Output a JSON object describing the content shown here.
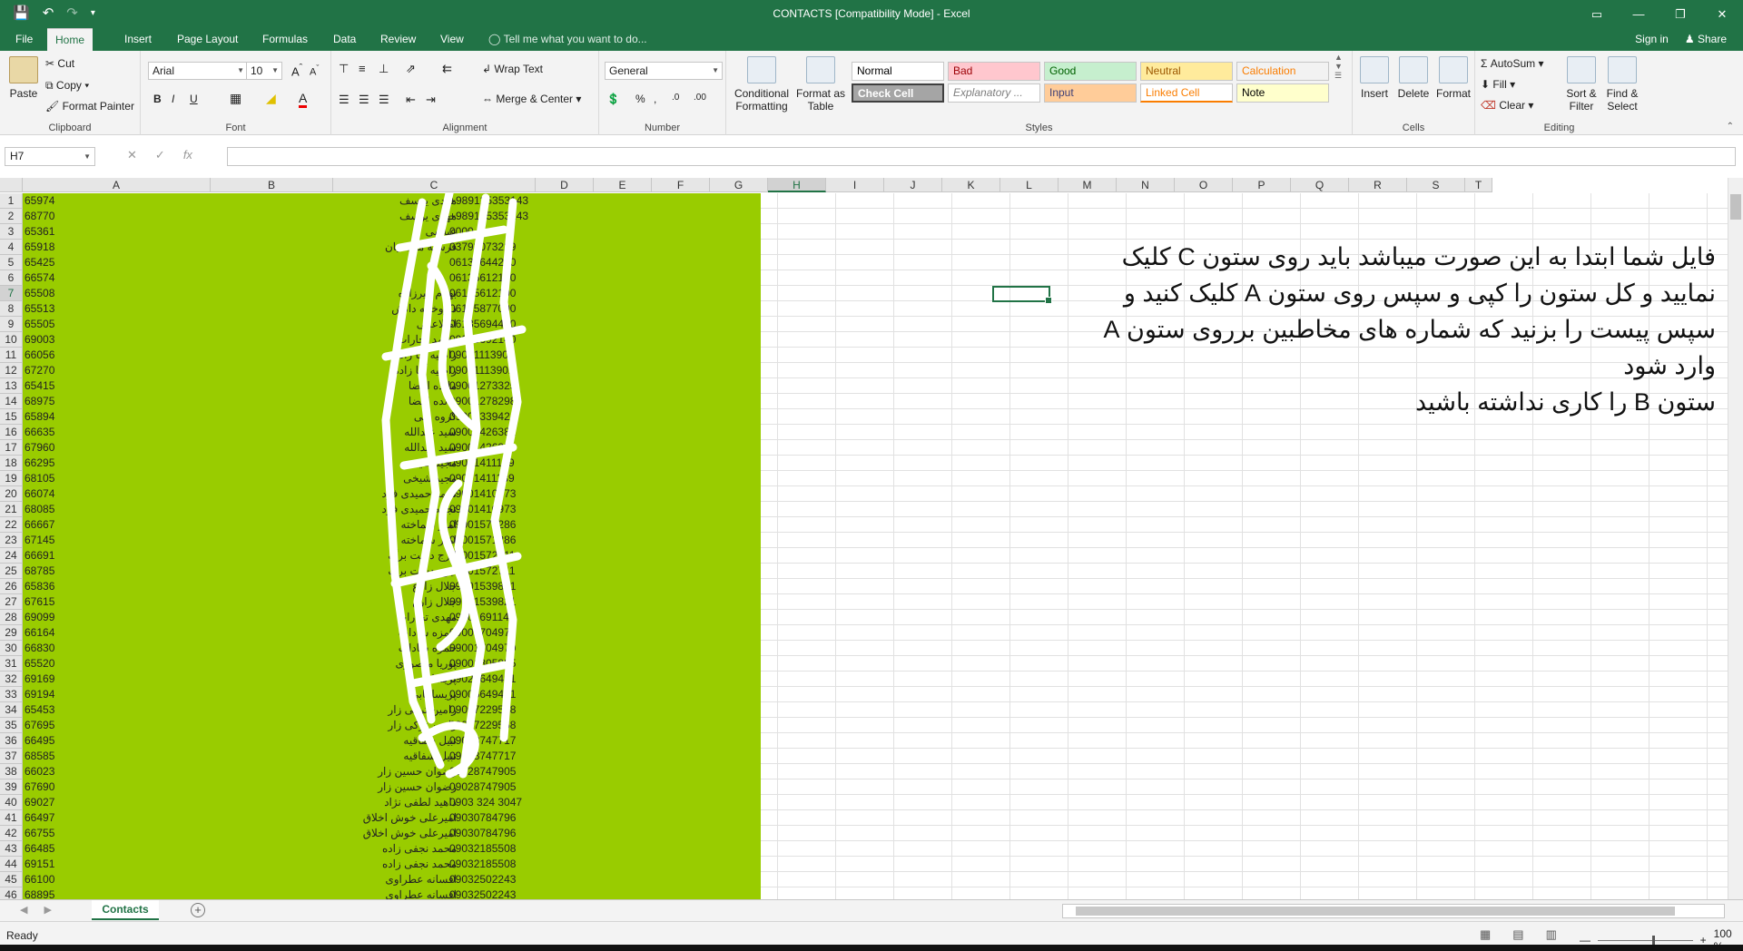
{
  "app": {
    "title": "CONTACTS  [Compatibility Mode] - Excel"
  },
  "tabs": [
    "File",
    "Home",
    "Insert",
    "Page Layout",
    "Formulas",
    "Data",
    "Review",
    "View"
  ],
  "tell_me": "Tell me what you want to do...",
  "account": {
    "signin": "Sign in",
    "share": "Share"
  },
  "ribbon": {
    "clipboard": {
      "label": "Clipboard",
      "paste": "Paste",
      "cut": "Cut",
      "copy": "Copy",
      "format_painter": "Format Painter"
    },
    "font": {
      "label": "Font",
      "name": "Arial",
      "size": "10"
    },
    "alignment": {
      "label": "Alignment",
      "wrap": "Wrap Text",
      "merge": "Merge & Center"
    },
    "number": {
      "label": "Number",
      "format": "General"
    },
    "styles": {
      "label": "Styles",
      "conditional": "Conditional Formatting",
      "format_table": "Format as Table",
      "cells": [
        {
          "name": "Normal",
          "bg": "#ffffff",
          "fg": "#000000"
        },
        {
          "name": "Bad",
          "bg": "#ffc7ce",
          "fg": "#9c0006"
        },
        {
          "name": "Good",
          "bg": "#c6efce",
          "fg": "#006100"
        },
        {
          "name": "Neutral",
          "bg": "#ffeb9c",
          "fg": "#9c5700"
        },
        {
          "name": "Calculation",
          "bg": "#f2f2f2",
          "fg": "#fa7d00"
        },
        {
          "name": "Check Cell",
          "bg": "#a5a5a5",
          "fg": "#ffffff"
        },
        {
          "name": "Explanatory ...",
          "bg": "#ffffff",
          "fg": "#7f7f7f"
        },
        {
          "name": "Input",
          "bg": "#ffcc99",
          "fg": "#3f3f76"
        },
        {
          "name": "Linked Cell",
          "bg": "#ffffff",
          "fg": "#fa7d00"
        },
        {
          "name": "Note",
          "bg": "#ffffcc",
          "fg": "#000000"
        }
      ]
    },
    "cells": {
      "label": "Cells",
      "insert": "Insert",
      "delete": "Delete",
      "format": "Format"
    },
    "editing": {
      "label": "Editing",
      "autosum": "AutoSum",
      "fill": "Fill",
      "clear": "Clear",
      "sort": "Sort & Filter",
      "find": "Find & Select"
    }
  },
  "formula": {
    "namebox": "H7",
    "value": ""
  },
  "columns": [
    "A",
    "B",
    "C",
    "D",
    "E",
    "F",
    "G",
    "H",
    "I",
    "J",
    "K",
    "L",
    "M",
    "N",
    "O",
    "P",
    "Q",
    "R",
    "S",
    "T"
  ],
  "selected_col": "H",
  "selected_row": 7,
  "rows": [
    {
      "n": 1,
      "a": "65974",
      "b": "مهدی یوسف",
      "c": "+989125353143"
    },
    {
      "n": 2,
      "a": "68770",
      "b": "مهدی یوسف",
      "c": "+989125353143"
    },
    {
      "n": 3,
      "a": "65361",
      "b": "عباسی",
      "c": "0000"
    },
    {
      "n": 4,
      "a": "65918",
      "b": "فرشته محمدیان",
      "c": "03793073229"
    },
    {
      "n": 5,
      "a": "65425",
      "b": "",
      "c": "06135644200"
    },
    {
      "n": 6,
      "a": "66574",
      "b": "",
      "c": "06135612100"
    },
    {
      "n": 7,
      "a": "65508",
      "b": "بهنام میرزاده",
      "c": "06135612100"
    },
    {
      "n": 8,
      "a": "65513",
      "b": "داروخانه دانش",
      "c": "06135877000"
    },
    {
      "n": 9,
      "a": "65505",
      "b": "اطلاعاتی",
      "c": "06135694400"
    },
    {
      "n": 10,
      "a": "69003",
      "b": "محمد تجارات",
      "c": "09006392140"
    },
    {
      "n": 11,
      "a": "66056",
      "b": "راضیه آقا زاده",
      "c": "09001113902"
    },
    {
      "n": 12,
      "a": "67270",
      "b": "راضیه آقا زاده",
      "c": "09001113902"
    },
    {
      "n": 13,
      "a": "65415",
      "b": "مائده امضا",
      "c": "09001273325"
    },
    {
      "n": 14,
      "a": "68975",
      "b": "مائده امضا",
      "c": "09001278298"
    },
    {
      "n": 15,
      "a": "65894",
      "b": "گروه فنی",
      "c": "09001339424"
    },
    {
      "n": 16,
      "a": "66635",
      "b": "سید عبدالله",
      "c": "09001426381"
    },
    {
      "n": 17,
      "a": "67960",
      "b": "سید عبدالله",
      "c": "09001426381"
    },
    {
      "n": 18,
      "a": "66295",
      "b": "مجید شیخی",
      "c": "09001411139"
    },
    {
      "n": 19,
      "a": "68105",
      "b": "مجید شیخی",
      "c": "09001411139"
    },
    {
      "n": 20,
      "a": "66074",
      "b": "نجمه حمیدی فرد",
      "c": "09001410973"
    },
    {
      "n": 21,
      "a": "68085",
      "b": "نجمه حمیدی فرد",
      "c": "09001410973"
    },
    {
      "n": 22,
      "a": "66667",
      "b": "امیر شماخته",
      "c": "09001571286"
    },
    {
      "n": 23,
      "a": "67145",
      "b": "امیر شماخته",
      "c": "09001571286"
    },
    {
      "n": 24,
      "a": "66691",
      "b": "ایرج دشت برگ",
      "c": "09001572711"
    },
    {
      "n": 25,
      "a": "68785",
      "b": "ایرج دشت برگ",
      "c": "09001572711"
    },
    {
      "n": 26,
      "a": "65836",
      "b": "جلال زارع",
      "c": "09001539821"
    },
    {
      "n": 27,
      "a": "67615",
      "b": "جلال زارع",
      "c": "09001539821"
    },
    {
      "n": 28,
      "a": "69099",
      "b": "مهدی تجارات",
      "c": "09001691140"
    },
    {
      "n": 29,
      "a": "66164",
      "b": "حمزه سادات",
      "c": "09001704970"
    },
    {
      "n": 30,
      "a": "66830",
      "b": "حمزه سادات",
      "c": "09001704970"
    },
    {
      "n": 31,
      "a": "65520",
      "b": "پوریا منصوری",
      "c": "09001805835"
    },
    {
      "n": 32,
      "a": "69169",
      "b": "پریسا بابی",
      "c": "09025649491"
    },
    {
      "n": 33,
      "a": "69194",
      "b": "پریسا بابی",
      "c": "09005649491"
    },
    {
      "n": 34,
      "a": "65453",
      "b": "رامین ترکی زار",
      "c": "09007229568"
    },
    {
      "n": 35,
      "a": "67695",
      "b": "رامین ترکی زار",
      "c": "09007229568"
    },
    {
      "n": 36,
      "a": "66495",
      "b": "نبیل شفاقیه",
      "c": "09008747717"
    },
    {
      "n": 37,
      "a": "68585",
      "b": "نبیل شفاقیه",
      "c": "09008747717"
    },
    {
      "n": 38,
      "a": "66023",
      "b": "رضوان حسین زار",
      "c": "09028747905"
    },
    {
      "n": 39,
      "a": "67690",
      "b": "رضوان حسین زار",
      "c": "09028747905"
    },
    {
      "n": 40,
      "a": "69027",
      "b": "داهید لطفی نژاد",
      "c": "0903 324 3047"
    },
    {
      "n": 41,
      "a": "66497",
      "b": "امیرعلی خوش اخلاق",
      "c": "09030784796"
    },
    {
      "n": 42,
      "a": "66755",
      "b": "امیرعلی خوش اخلاق",
      "c": "09030784796"
    },
    {
      "n": 43,
      "a": "66485",
      "b": "محمد نجفی زاده",
      "c": "09032185508"
    },
    {
      "n": 44,
      "a": "69151",
      "b": "محمد نجفی زاده",
      "c": "09032185508"
    },
    {
      "n": 45,
      "a": "66100",
      "b": "افسانه عطراوی",
      "c": "09032502243"
    },
    {
      "n": 46,
      "a": "68895",
      "b": "افسانه عطراوی",
      "c": "09032502243"
    }
  ],
  "note": [
    "فایل شما ابتدا به این صورت میباشد باید روی ستون C کلیک",
    "نمایید و کل ستون را کپی و سپس روی ستون A کلیک کنید  و",
    "سپس پیست را بزنید که شماره های مخاطبین برروی ستون A",
    "وارد شود",
    "ستون B را کاری نداشته باشید"
  ],
  "sheet": {
    "name": "Contacts"
  },
  "status": {
    "ready": "Ready",
    "zoom": "100 %"
  },
  "colors": {
    "brand": "#217346",
    "fill": "#99cc00"
  }
}
